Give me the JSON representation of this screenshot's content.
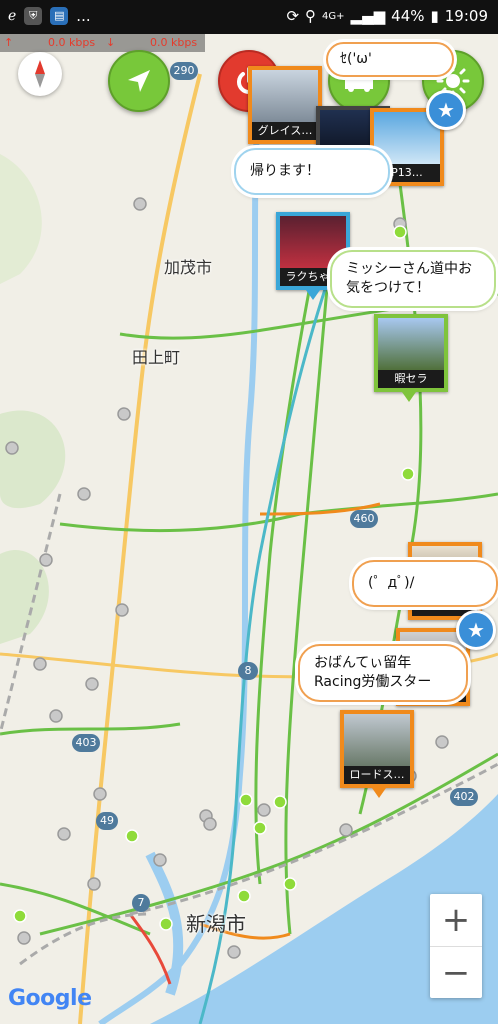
{
  "status_bar": {
    "time": "19:09",
    "battery": "44%",
    "network": "4G+",
    "more": "..."
  },
  "speed_bar": {
    "upload": "0.0 kbps",
    "download": "0.0 kbps"
  },
  "map_labels": {
    "kamo": "加茂市",
    "tagami": "田上町",
    "niigata": "新潟市"
  },
  "route_shields": [
    "290",
    "460",
    "8",
    "403",
    "49",
    "7",
    "402"
  ],
  "pins": [
    {
      "caption": "グレイス…"
    },
    {
      "caption": ""
    },
    {
      "caption": "P13…"
    },
    {
      "caption": "ラクちゃ…"
    },
    {
      "caption": "暇セラ"
    },
    {
      "caption": ""
    },
    {
      "caption": ""
    },
    {
      "caption": "ロードス…"
    }
  ],
  "bubbles": [
    {
      "text": "ｾ('ω'"
    },
    {
      "text": "帰ります！"
    },
    {
      "text": "ミッシーさん道中お気をつけて！"
    },
    {
      "text": "(゜дﾟ)/"
    },
    {
      "text": "おばんてぃ留年Racing労働スター"
    }
  ],
  "zoom": {
    "in": "+",
    "out": "−"
  },
  "google_logo": "Google",
  "colors": {
    "accent_green": "#78c83a",
    "accent_red": "#e23a2e",
    "pin_orange": "#f08a1c",
    "sea": "#9ccdf0"
  }
}
